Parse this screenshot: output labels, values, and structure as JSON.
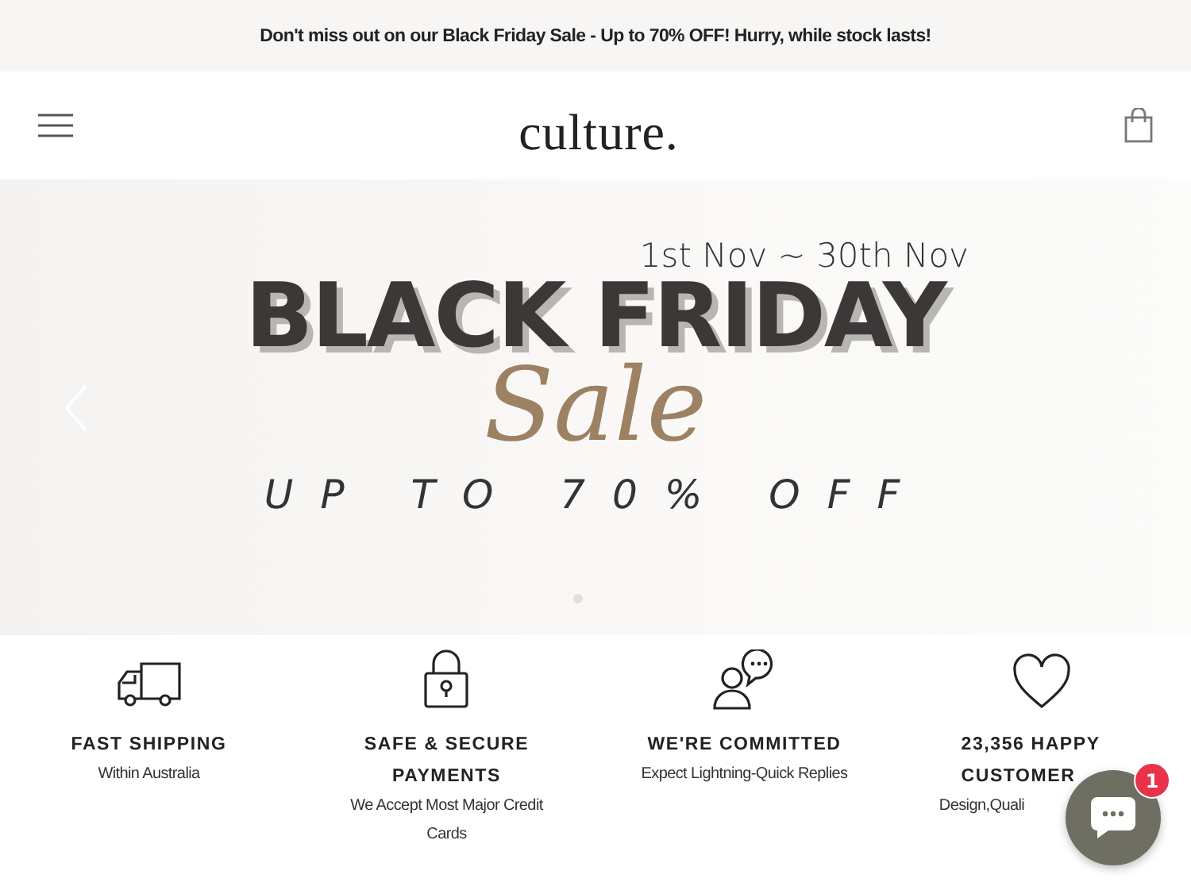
{
  "announcement": "Don't miss out on our Black Friday Sale - Up to 70% OFF! Hurry, while stock lasts!",
  "header": {
    "logo": "culture."
  },
  "hero": {
    "dates": "1st Nov ~ 30th Nov",
    "title": "BLACK FRIDAY",
    "script": "Sale",
    "offer": "UP TO 70% OFF",
    "dots": [
      {
        "selected": true
      }
    ]
  },
  "features": [
    {
      "kind": "truck",
      "title": "FAST SHIPPING",
      "text": "Within Australia"
    },
    {
      "kind": "lock",
      "title": "SAFE & SECURE PAYMENTS",
      "text": "We Accept Most Major Credit Cards"
    },
    {
      "kind": "support",
      "title": "WE'RE COMMITTED",
      "text": "Expect Lightning-Quick Replies"
    },
    {
      "kind": "heart",
      "title": "23,356 HAPPY CUSTOMER",
      "text": "Design,Quali"
    }
  ],
  "chat": {
    "badge": "1"
  }
}
